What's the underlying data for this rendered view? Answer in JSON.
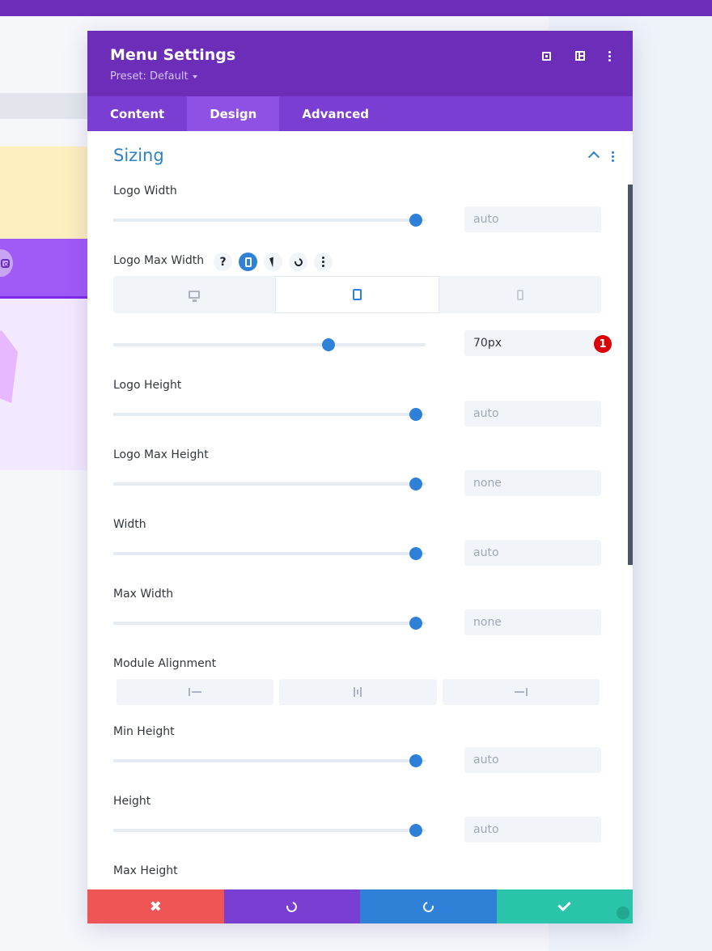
{
  "modal": {
    "title": "Menu Settings",
    "preset": "Preset: Default",
    "header_icons": [
      "expand-icon",
      "split-view-icon",
      "more-options-icon"
    ],
    "tabs": [
      {
        "label": "Content",
        "active": false
      },
      {
        "label": "Design",
        "active": true
      },
      {
        "label": "Advanced",
        "active": false
      }
    ]
  },
  "section": {
    "title": "Sizing",
    "collapse_icon": "chevron-up-icon"
  },
  "fields": {
    "logo_width": {
      "label": "Logo Width",
      "value": "auto",
      "slider_fraction": 0.97
    },
    "logo_max_width": {
      "label": "Logo Max Width",
      "help_label": "?",
      "value": "70px",
      "slider_fraction": 0.69,
      "badge": "1",
      "devices": [
        "desktop-icon",
        "tablet-icon",
        "phone-icon"
      ],
      "active_device": "tablet"
    },
    "logo_height": {
      "label": "Logo Height",
      "value": "auto",
      "slider_fraction": 0.97
    },
    "logo_max_height": {
      "label": "Logo Max Height",
      "value": "none",
      "slider_fraction": 0.97
    },
    "width": {
      "label": "Width",
      "value": "auto",
      "slider_fraction": 0.97
    },
    "max_width": {
      "label": "Max Width",
      "value": "none",
      "slider_fraction": 0.97
    },
    "module_alignment": {
      "label": "Module Alignment",
      "options": [
        "align-left-icon",
        "align-center-icon",
        "align-right-icon"
      ]
    },
    "min_height": {
      "label": "Min Height",
      "value": "auto",
      "slider_fraction": 0.97
    },
    "height": {
      "label": "Height",
      "value": "auto",
      "slider_fraction": 0.97
    },
    "max_height": {
      "label": "Max Height"
    }
  },
  "footer": {
    "cancel_glyph": "✖",
    "buttons": [
      "close-icon",
      "undo-icon",
      "redo-icon",
      "check-icon"
    ]
  },
  "colors": {
    "header": "#6c2eb9",
    "tabs": "#7b3ed2",
    "accent": "#2e81d7",
    "cancel": "#ef5555",
    "save": "#29c4a9",
    "badge": "#db0007"
  }
}
